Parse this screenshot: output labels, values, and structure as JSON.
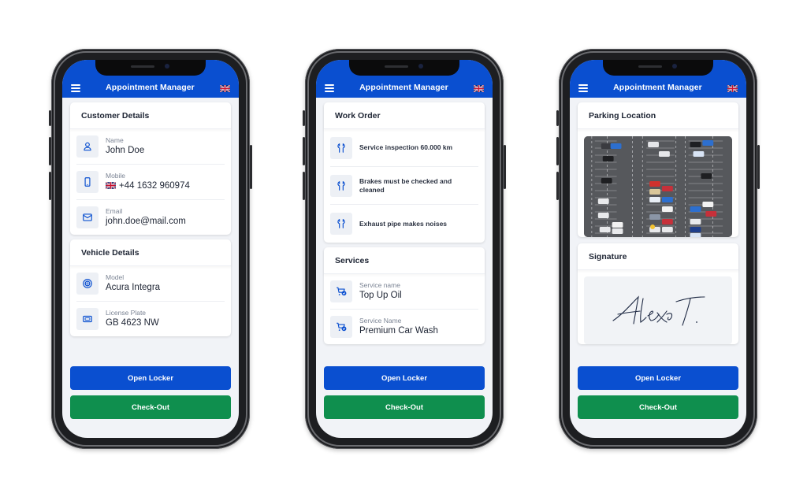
{
  "app": {
    "title": "Appointment Manager",
    "menu_icon": "hamburger-menu-icon",
    "language_icon": "uk-flag-icon"
  },
  "colors": {
    "primary": "#0a4fd0",
    "success": "#0f8f4e",
    "background": "#f1f3f7",
    "icon_bg": "#edf0f5"
  },
  "screens": [
    {
      "sections": {
        "customer": {
          "title": "Customer Details",
          "items": [
            {
              "icon": "user-icon",
              "label": "Name",
              "value": "John Doe"
            },
            {
              "icon": "phone-icon",
              "label": "Mobile",
              "value": "+44 1632 960974",
              "flag": "uk-flag-icon"
            },
            {
              "icon": "mail-icon",
              "label": "Email",
              "value": "john.doe@mail.com"
            }
          ]
        },
        "vehicle": {
          "title": "Vehicle Details",
          "items": [
            {
              "icon": "wheel-icon",
              "label": "Model",
              "value": "Acura Integra"
            },
            {
              "icon": "license-plate-icon",
              "label": "License Plate",
              "value": "GB 4623 NW"
            }
          ]
        }
      },
      "buttons": {
        "primary": "Open Locker",
        "secondary": "Check-Out"
      }
    },
    {
      "sections": {
        "work_order": {
          "title": "Work Order",
          "items": [
            {
              "icon": "wrench-icon",
              "text": "Service inspection 60.000 km"
            },
            {
              "icon": "wrench-icon",
              "text": "Brakes must be checked and cleaned"
            },
            {
              "icon": "wrench-icon",
              "text": "Exhaust pipe makes noises"
            }
          ]
        },
        "services": {
          "title": "Services",
          "items": [
            {
              "icon": "cart-check-icon",
              "label": "Service name",
              "value": "Top Up Oil"
            },
            {
              "icon": "cart-check-icon",
              "label": "Service Name",
              "value": "Premium Car Wash"
            }
          ]
        }
      },
      "buttons": {
        "primary": "Open Locker",
        "secondary": "Check-Out"
      }
    },
    {
      "sections": {
        "parking": {
          "title": "Parking Location",
          "image": "aerial-parking-lot-photo"
        },
        "signature": {
          "title": "Signature",
          "value": "Alex T."
        }
      },
      "buttons": {
        "primary": "Open Locker",
        "secondary": "Check-Out"
      }
    }
  ]
}
